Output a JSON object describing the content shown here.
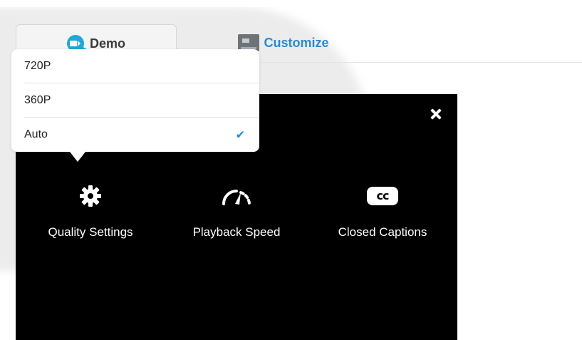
{
  "tabs": {
    "demo_label": "Demo",
    "customize_label": "Customize"
  },
  "player": {
    "options": [
      {
        "label": "Quality Settings",
        "icon": "gear-icon"
      },
      {
        "label": "Playback Speed",
        "icon": "speedometer-icon"
      },
      {
        "label": "Closed Captions",
        "icon": "cc-icon",
        "icon_text": "cc"
      }
    ]
  },
  "quality_menu": {
    "items": [
      {
        "label": "720P",
        "selected": false
      },
      {
        "label": "360P",
        "selected": false
      },
      {
        "label": "Auto",
        "selected": true
      }
    ],
    "check_glyph": "✔"
  },
  "colors": {
    "accent": "#2a8ad0",
    "demo_icon": "#22a6d8",
    "check": "#1f8ee0",
    "panel": "#000000"
  }
}
